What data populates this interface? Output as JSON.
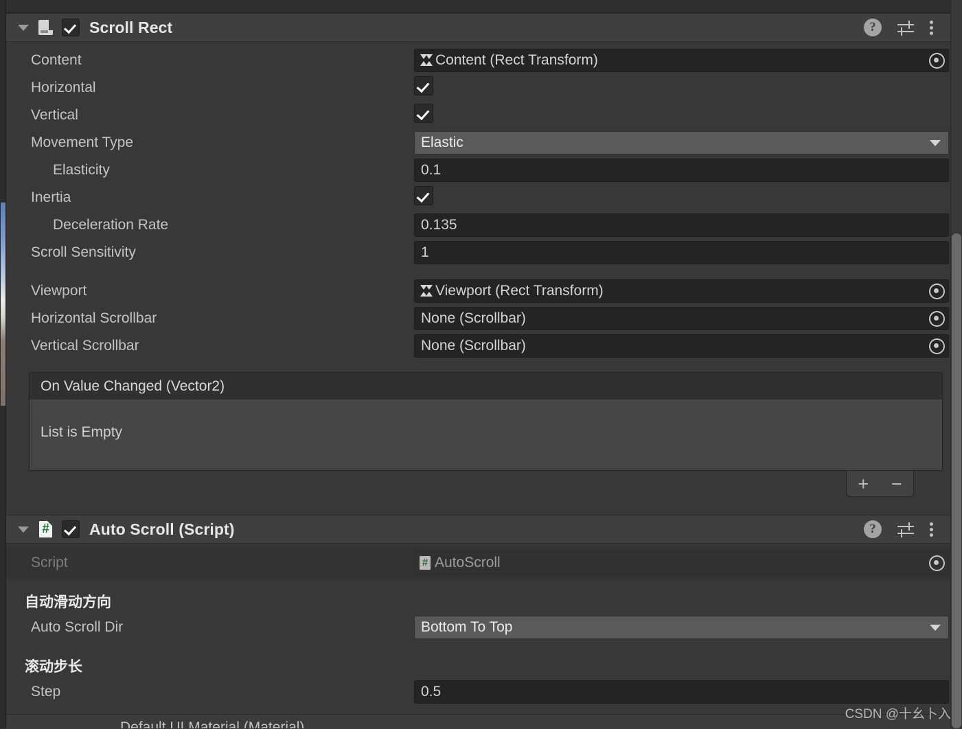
{
  "window": {
    "watermark": "CSDN @十幺卜入"
  },
  "components": [
    {
      "title": "Scroll Rect",
      "icon": "scroll-rect-icon",
      "enabled": true,
      "expanded": true,
      "header_icons": {
        "help": "?",
        "preset": "preset-icon",
        "menu": "more-menu-icon"
      },
      "fields": {
        "content": {
          "label": "Content",
          "value": "Content (Rect Transform)",
          "icon": "rect-transform-icon"
        },
        "horizontal": {
          "label": "Horizontal",
          "value": true
        },
        "vertical": {
          "label": "Vertical",
          "value": true
        },
        "movement_type": {
          "label": "Movement Type",
          "value": "Elastic"
        },
        "elasticity": {
          "label": "Elasticity",
          "value": "0.1"
        },
        "inertia": {
          "label": "Inertia",
          "value": true
        },
        "deceleration_rate": {
          "label": "Deceleration Rate",
          "value": "0.135"
        },
        "scroll_sensitivity": {
          "label": "Scroll Sensitivity",
          "value": "1"
        },
        "viewport": {
          "label": "Viewport",
          "value": "Viewport (Rect Transform)",
          "icon": "rect-transform-icon"
        },
        "horizontal_scrollbar": {
          "label": "Horizontal Scrollbar",
          "value": "None (Scrollbar)"
        },
        "vertical_scrollbar": {
          "label": "Vertical Scrollbar",
          "value": "None (Scrollbar)"
        }
      },
      "event": {
        "title": "On Value Changed (Vector2)",
        "empty_text": "List is Empty",
        "add_label": "+",
        "remove_label": "−"
      }
    },
    {
      "title": "Auto Scroll (Script)",
      "icon": "csharp-script-icon",
      "enabled": true,
      "expanded": true,
      "header_icons": {
        "help": "?",
        "preset": "preset-icon",
        "menu": "more-menu-icon"
      },
      "fields": {
        "script": {
          "label": "Script",
          "value": "AutoScroll",
          "icon": "csharp-script-icon"
        },
        "dir_header": {
          "label": "自动滑动方向"
        },
        "auto_scroll_dir": {
          "label": "Auto Scroll Dir",
          "value": "Bottom To Top"
        },
        "step_header": {
          "label": "滚动步长"
        },
        "step": {
          "label": "Step",
          "value": "0.5"
        }
      }
    }
  ],
  "partial_row": {
    "value": "Default UI Material (Material)"
  }
}
